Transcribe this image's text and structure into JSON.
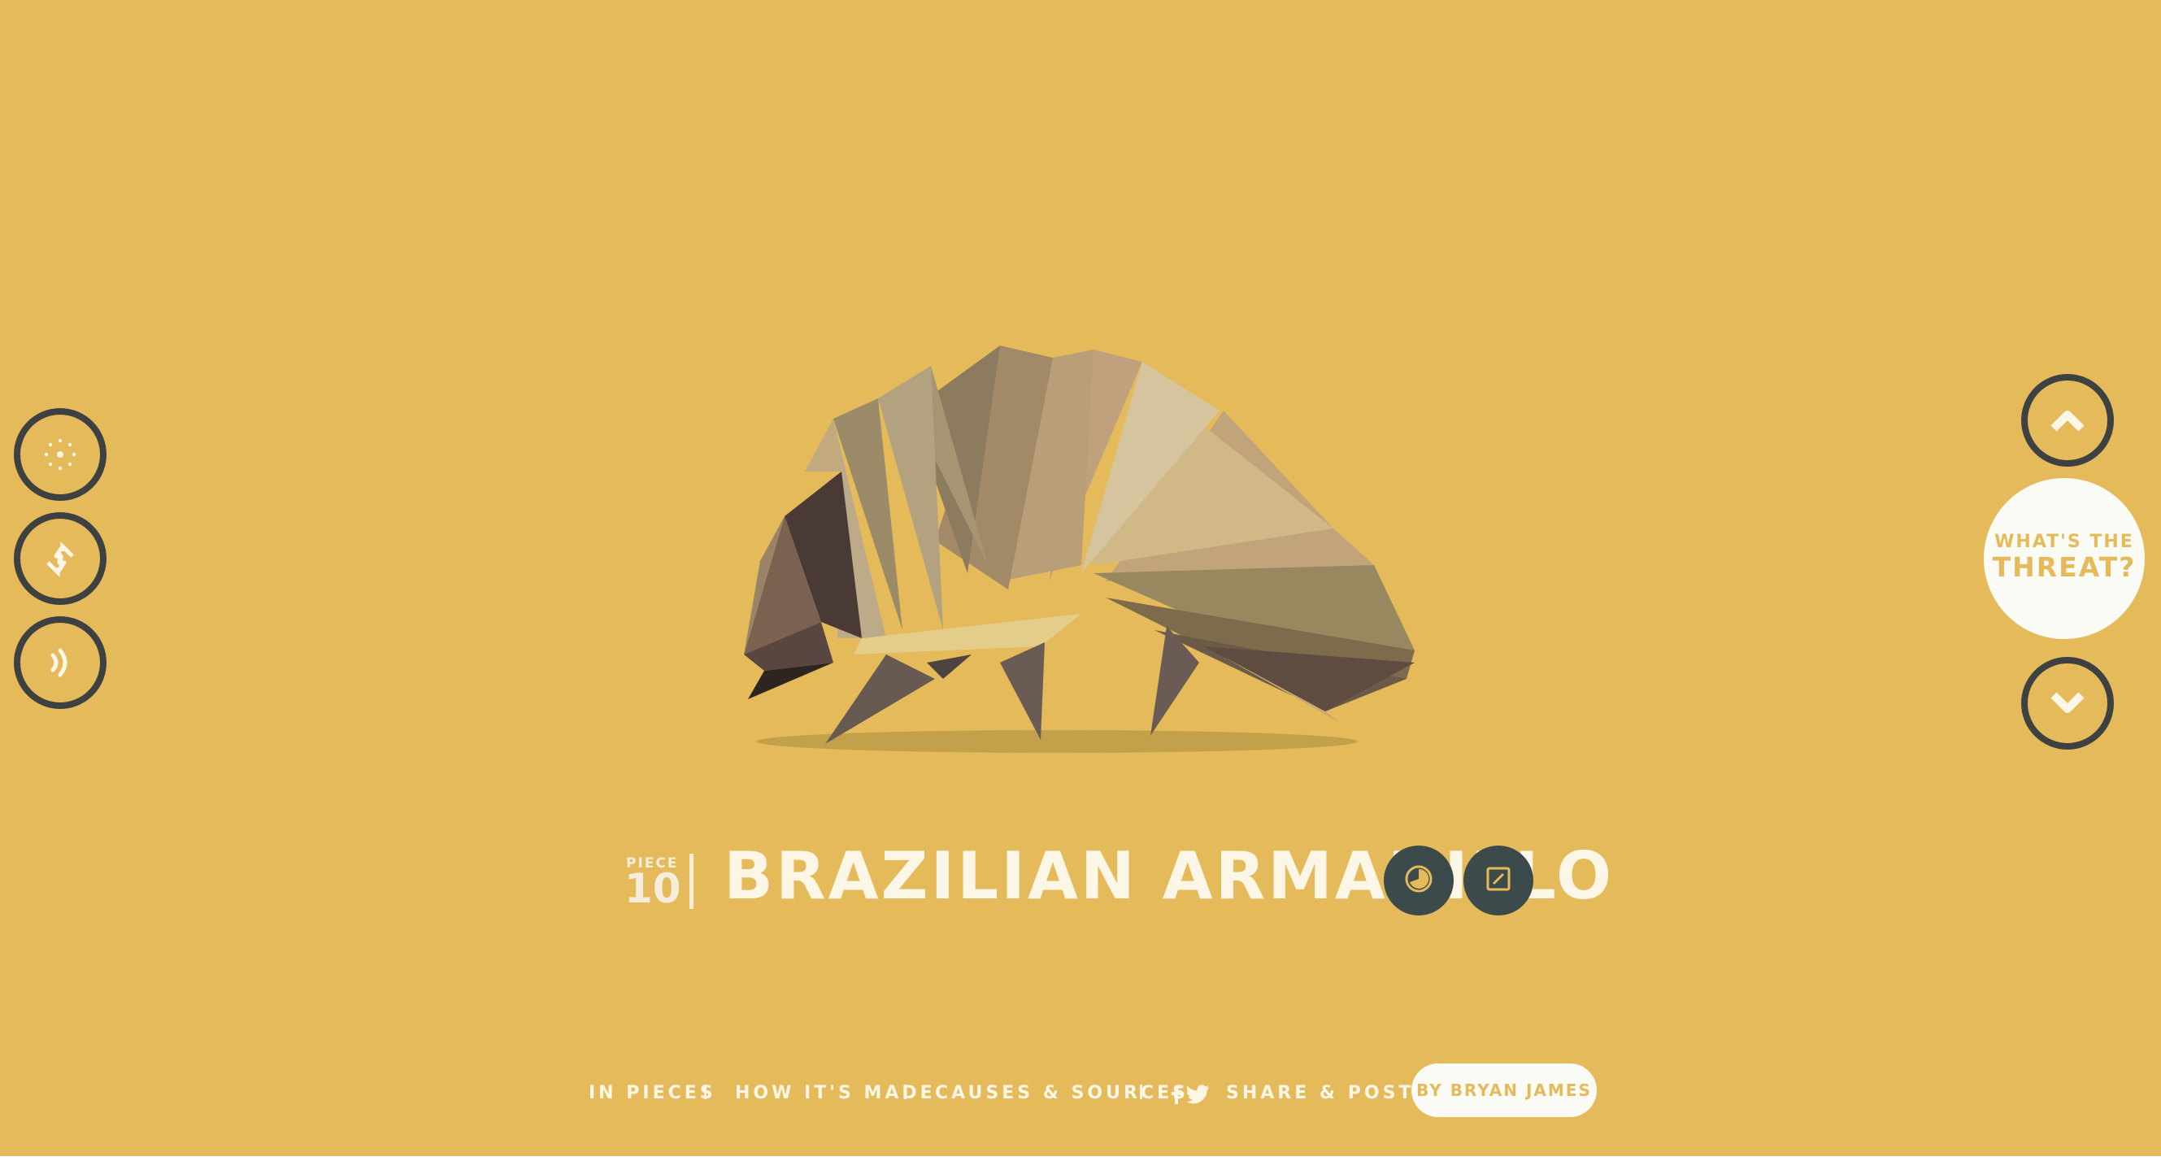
{
  "page": {
    "background_color": "#e4ba5a",
    "accent_dark": "#3d4142",
    "text_light": "#fbf6e6"
  },
  "left_controls": {
    "items": [
      {
        "name": "particles-toggle",
        "icon": "dots-burst-icon"
      },
      {
        "name": "shuffle-toggle",
        "icon": "swap-arrows-icon"
      },
      {
        "name": "sound-toggle",
        "icon": "sound-waves-icon"
      }
    ]
  },
  "right_nav": {
    "up_icon": "chevron-up-icon",
    "down_icon": "chevron-down-icon",
    "threat_line1": "WHAT'S THE",
    "threat_line2": "THREAT?"
  },
  "title_block": {
    "piece_label": "PIECE",
    "piece_number": "10",
    "animal_name": "BRAZILIAN ARMADILLO",
    "info_icons": [
      "pie-chart-icon",
      "resize-icon"
    ]
  },
  "footer": {
    "links": [
      "IN PIECES",
      "HOW IT'S MADE",
      "CAUSES & SOURCES",
      "SHARE & POSTER"
    ],
    "social_icons": [
      "facebook-icon",
      "twitter-icon"
    ],
    "author_label": "BY BRYAN JAMES"
  }
}
